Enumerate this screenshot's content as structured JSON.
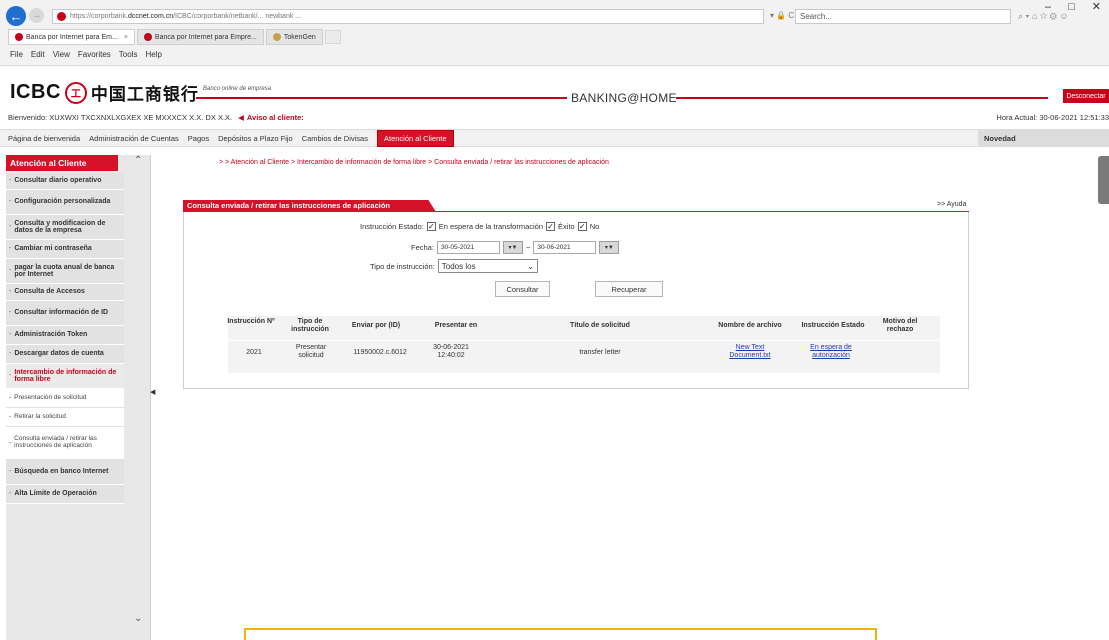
{
  "browser": {
    "url": "https://corporbank.icbc.dccnet.com.cn/...",
    "url_prefix": "https://corporbank",
    "url_host": ".dccnet.com.cn",
    "url_suffix": "/ICBC/corporbank/netbank/... newbank ...",
    "addr_tools": "▾ 🔒 C",
    "search_placeholder": "Search...",
    "tabs": [
      {
        "label": "Banca por Internet para Em...",
        "active": true
      },
      {
        "label": "Banca por Internet para Empre...",
        "active": false
      },
      {
        "label": "TokenGen",
        "active": false
      }
    ],
    "menu": [
      "File",
      "Edit",
      "View",
      "Favorites",
      "Tools",
      "Help"
    ],
    "window_controls": [
      "–",
      "□",
      "✕"
    ],
    "toolbar_icons": "⌕ ▾   ⌂ ☆ ⚙ ☺"
  },
  "header": {
    "logo_latin": "ICBC",
    "logo_seal": "工",
    "logo_cn": "中国工商银行",
    "tagline": "Banco online de empresa",
    "site_title": "BANKING@HOME",
    "logout_label": "Desconectar"
  },
  "welcome": {
    "greeting": "Bienvenido: XUXWXI TXCXNXLXGXEX XE MXXXCX X.X. DX X.X.",
    "alert_label": "Aviso al cliente:",
    "clock": "Hora Actual: 30-06-2021 12:51:33"
  },
  "main_nav": {
    "items": [
      {
        "label": "Página de bienvenida",
        "active": false
      },
      {
        "label": "Administración de Cuentas",
        "active": false
      },
      {
        "label": "Pagos",
        "active": false
      },
      {
        "label": "Depósitos a Plazo Fijo",
        "active": false
      },
      {
        "label": "Cambios de Divisas",
        "active": false
      },
      {
        "label": "Atención al Cliente",
        "active": true
      }
    ],
    "news_label": "Novedad"
  },
  "sidebar": {
    "title": "Atención al Cliente",
    "items": [
      {
        "label": "Consultar diario operativo",
        "type": "item"
      },
      {
        "label": "Configuración personalizada",
        "type": "item"
      },
      {
        "label": "Consulta y modificacion de datos de la empresa",
        "type": "item"
      },
      {
        "label": "Cambiar mi contraseña",
        "type": "item"
      },
      {
        "label": "pagar la cuota anual de banca por Internet",
        "type": "item"
      },
      {
        "label": "Consulta de Accesos",
        "type": "item"
      },
      {
        "label": "Consultar información de ID",
        "type": "item"
      },
      {
        "label": "Administración Token",
        "type": "item"
      },
      {
        "label": "Descargar datos de cuenta",
        "type": "item"
      },
      {
        "label": "Intercambio de información de forma libre",
        "type": "selected"
      },
      {
        "label": "Presentación de solicitud",
        "type": "sub"
      },
      {
        "label": "Retirar la solicitud",
        "type": "sub"
      },
      {
        "label": "Consulta enviada / retirar las instrucciones de aplicación",
        "type": "sub"
      },
      {
        "label": "Búsqueda en banco Internet",
        "type": "item"
      },
      {
        "label": "Alta Límite de Operación",
        "type": "item"
      }
    ]
  },
  "breadcrumb": "> > Atención al Cliente > Intercambio de información de forma libre > Consulta enviada / retirar las instrucciones de aplicación",
  "panel": {
    "title": "Consulta enviada / retirar las instrucciones de aplicación",
    "help_label": ">> Ayuda",
    "status_label": "Instrucción Estado:",
    "status_options": [
      {
        "label": "En espera de la transformación",
        "checked": true
      },
      {
        "label": "Éxito",
        "checked": true
      },
      {
        "label": "No",
        "checked": true
      }
    ],
    "date_label": "Fecha:",
    "date_from": "30-05-2021",
    "date_to": "30-06-2021",
    "date_separator": "~",
    "type_label": "Tipo de instrucción:",
    "type_value": "Todos los",
    "consult_button": "Consultar",
    "recover_button": "Recuperar"
  },
  "table": {
    "headers": [
      "Instrucción Nº",
      "Tipo de instrucción",
      "Enviar por (ID)",
      "Presentar en",
      "Título de solicitud",
      "Nombre de archivo",
      "Instrucción Estado",
      "Motivo del rechazo"
    ],
    "rows": [
      {
        "number": "2021",
        "type": "Presentar solicitud",
        "sent_by": "11950002.c.6012",
        "submitted": "30-06-2021 12:40:02",
        "title": "transfer letter",
        "file": "New Text Document.txt",
        "status": "En espera de autorización",
        "reason": ""
      }
    ]
  },
  "colors": {
    "brand_red": "#d6112a",
    "link_blue": "#1a3ea8",
    "notice_border": "#f0b400"
  }
}
